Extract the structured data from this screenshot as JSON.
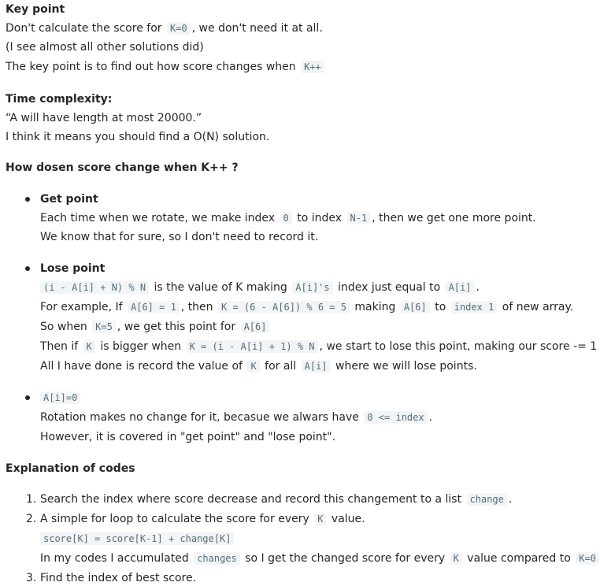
{
  "key_point": {
    "heading": "Key point",
    "l1_a": "Don't calculate the score for",
    "l1_code": "K=0",
    "l1_b": ", we don't need it at all.",
    "l2": "(I see almost all other solutions did)",
    "l3_a": "The key point is to find out how score changes when",
    "l3_code": "K++"
  },
  "time": {
    "heading": "Time complexity:",
    "l1": "“A will have length at most 20000.”",
    "l2": "I think it means you should find a O(N) solution."
  },
  "how": {
    "heading": "How dosen score change when K++ ?"
  },
  "get_point": {
    "title": "Get point",
    "l1_a": "Each time when we rotate, we make index",
    "l1_c1": "0",
    "l1_b": "to index",
    "l1_c2": "N-1",
    "l1_c": ", then we get one more point.",
    "l2": "We know that for sure, so I don't need to record it."
  },
  "lose_point": {
    "title": "Lose point",
    "l1_c1": "(i - A[i] + N) % N",
    "l1_a": "is the value of K making",
    "l1_c2": "A[i]'s",
    "l1_b": "index just equal to",
    "l1_c3": "A[i]",
    "l1_c": ".",
    "l2_a": "For example, If",
    "l2_c1": "A[6] = 1",
    "l2_b": ", then",
    "l2_c2": "K = (6 - A[6]) % 6 = 5",
    "l2_c": "making",
    "l2_c3": "A[6]",
    "l2_d": "to",
    "l2_c4": "index 1",
    "l2_e": "of new array.",
    "l3_a": "So when",
    "l3_c1": "K=5",
    "l3_b": ", we get this point for",
    "l3_c2": "A[6]",
    "l4_a": "Then if",
    "l4_c1": "K",
    "l4_b": "is bigger when",
    "l4_c2": "K = (i - A[i] + 1) % N",
    "l4_c": ", we start to lose this point, making our score -= 1",
    "l5_a": "All I have done is record the value of",
    "l5_c1": "K",
    "l5_b": "for all",
    "l5_c2": "A[i]",
    "l5_c": "where we will lose points."
  },
  "a_zero": {
    "title_code": "A[i]=0",
    "l1_a": "Rotation makes no change for it, becasue we alwars have",
    "l1_code": "0 <= index",
    "l1_b": ".",
    "l2": "However, it is covered in \"get point\" and \"lose point\"."
  },
  "explanation": {
    "heading": "Explanation of codes",
    "i1_num": "1.",
    "i1_a": "Search the index where score decrease and record this changement to a list",
    "i1_code": "change",
    "i1_b": ".",
    "i2_num": "2.",
    "i2_a": "A simple for loop to calculate the score for every",
    "i2_code": "K",
    "i2_b": "value.",
    "i2_code_line": "score[K] = score[K-1] + change[K]",
    "i2_l3_a": "In my codes I accumulated",
    "i2_l3_c1": "changes",
    "i2_l3_b": "so I get the changed score for every",
    "i2_l3_c2": "K",
    "i2_l3_c": "value compared to",
    "i2_l3_c3": "K=0",
    "i3_num": "3.",
    "i3": "Find the index of best score."
  }
}
